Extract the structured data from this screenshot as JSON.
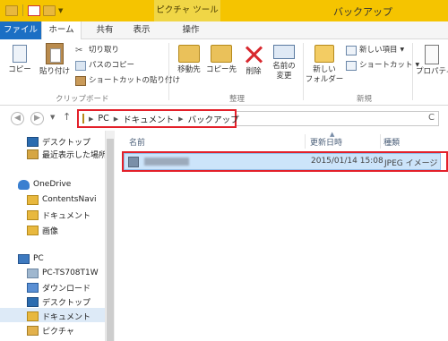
{
  "title_bar": {
    "context_tab": "ピクチャ ツール",
    "window_title": "バックアップ"
  },
  "tabs": {
    "file": "ファイル",
    "home": "ホーム",
    "share": "共有",
    "view": "表示",
    "manage": "操作"
  },
  "ribbon": {
    "clipboard": {
      "copy": "コピー",
      "paste": "貼り付け",
      "cut": "切り取り",
      "copy_path": "パスのコピー",
      "paste_shortcut": "ショートカットの貼り付け",
      "label": "クリップボード"
    },
    "organize": {
      "move_to": "移動先",
      "copy_to": "コピー先",
      "delete": "削除",
      "rename_line1": "名前の",
      "rename_line2": "変更",
      "label": "整理"
    },
    "new": {
      "new_folder_line1": "新しい",
      "new_folder_line2": "フォルダー",
      "new_item": "新しい項目",
      "shortcut": "ショートカット",
      "label": "新規"
    },
    "open": {
      "properties": "プロパティ"
    }
  },
  "address": {
    "crumbs": [
      "PC",
      "ドキュメント",
      "バックアップ"
    ],
    "icons": {
      "back": "◀",
      "forward": "▶",
      "history": "▼",
      "up": "↑",
      "refresh": "C"
    }
  },
  "nav": {
    "items": [
      {
        "label": "デスクトップ",
        "icon": "desktop-icon"
      },
      {
        "label": "最近表示した場所",
        "icon": "recent-places-icon"
      },
      {
        "label": "OneDrive",
        "icon": "onedrive-icon"
      },
      {
        "label": "ContentsNavi",
        "icon": "folder-icon"
      },
      {
        "label": "ドキュメント",
        "icon": "folder-icon"
      },
      {
        "label": "画像",
        "icon": "folder-icon"
      },
      {
        "label": "PC",
        "icon": "pc-icon"
      },
      {
        "label": "PC-TS708T1W",
        "icon": "computer-icon"
      },
      {
        "label": "ダウンロード",
        "icon": "download-icon"
      },
      {
        "label": "デスクトップ",
        "icon": "desktop-icon"
      },
      {
        "label": "ドキュメント",
        "icon": "folder-icon"
      },
      {
        "label": "ピクチャ",
        "icon": "pictures-icon"
      }
    ]
  },
  "file_list": {
    "columns": {
      "name": "名前",
      "date_modified": "更新日時",
      "type": "種類"
    },
    "rows": [
      {
        "date": "2015/01/14 15:08",
        "type": "JPEG イメージ"
      }
    ]
  },
  "colors": {
    "title_bar": "#f5c400",
    "file_tab": "#1b6fc4",
    "highlight_box": "#e3202a",
    "selected_row": "#cce4fa"
  }
}
